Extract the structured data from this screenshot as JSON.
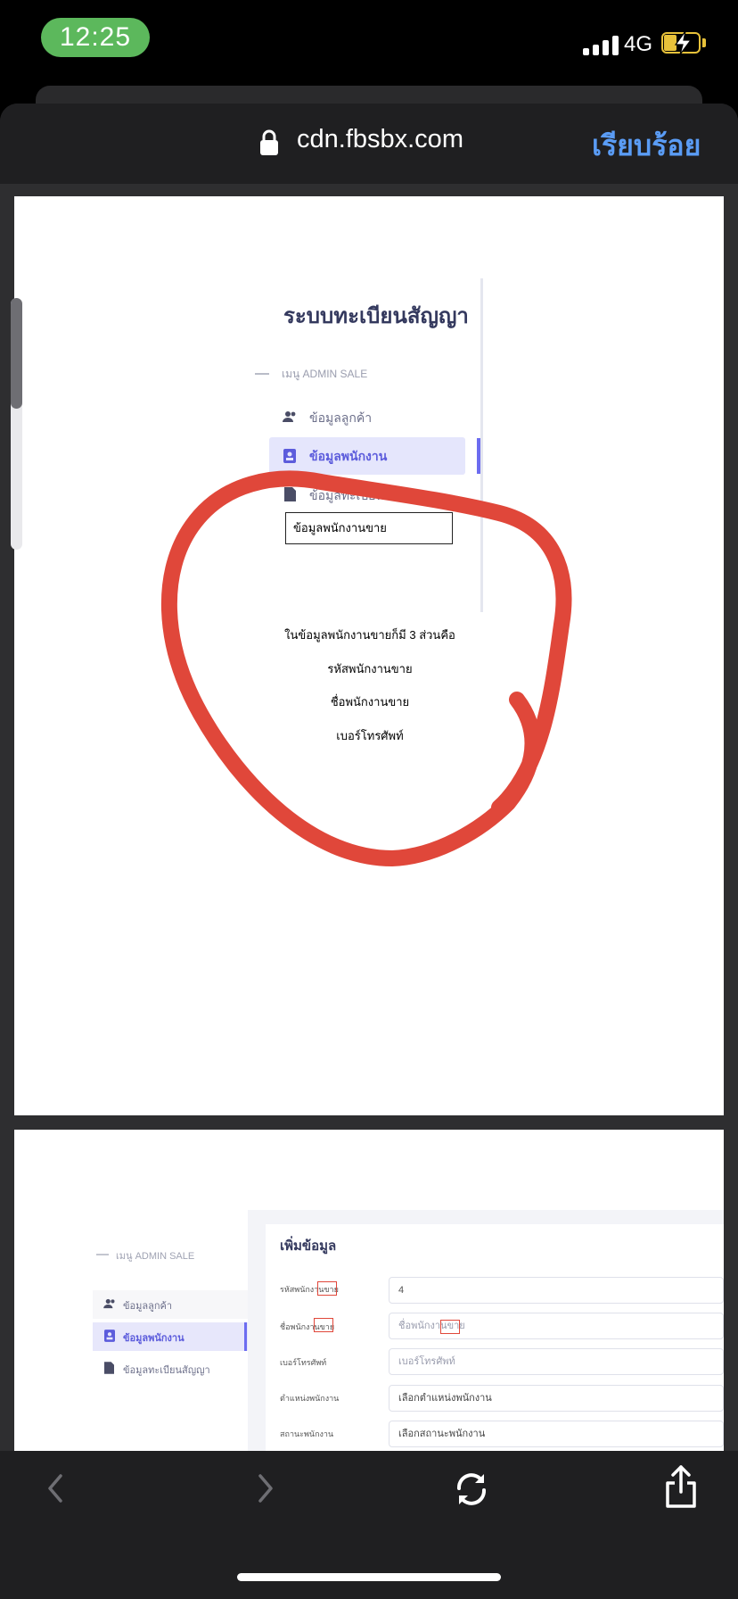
{
  "status_bar": {
    "time": "12:25",
    "network": "4G"
  },
  "browser": {
    "url": "cdn.fbsbx.com",
    "done_label": "เรียบร้อย"
  },
  "page1": {
    "title": "ระบบทะเบียนสัญญา",
    "menu_header": "เมนู ADMIN SALE",
    "menu_items": [
      {
        "label": "ข้อมูลลูกค้า",
        "icon": "users-icon"
      },
      {
        "label": "ข้อมูลพนักงาน",
        "icon": "id-card-icon"
      },
      {
        "label": "ข้อมูลทะเบียน",
        "icon": "document-icon"
      }
    ],
    "callout": "ข้อมูลพนักงานขาย",
    "notes": [
      "ในข้อมูลพนักงานขายก็มี 3 ส่วนคือ",
      "รหัสพนักงานขาย",
      "ชื่อพนักงานขาย",
      "เบอร์โทรศัพท์"
    ]
  },
  "page2": {
    "menu_header": "เมนู ADMIN SALE",
    "menu_items": [
      {
        "label": "ข้อมูลลูกค้า",
        "icon": "users-icon"
      },
      {
        "label": "ข้อมูลพนักงาน",
        "icon": "id-card-icon"
      },
      {
        "label": "ข้อมูลทะเบียนสัญญา",
        "icon": "document-icon"
      }
    ],
    "card_title": "เพิ่มข้อมูล",
    "form": [
      {
        "label": "รหัสพนักงานขาย",
        "value": "4",
        "placeholder": ""
      },
      {
        "label": "ชื่อพนักงานขาย",
        "value": "",
        "placeholder": "ชื่อพนักงานขาย"
      },
      {
        "label": "เบอร์โทรศัพท์",
        "value": "",
        "placeholder": "เบอร์โทรศัพท์"
      },
      {
        "label": "ตำแหน่งพนักงาน",
        "value": "เลือกตำแหน่งพนักงาน",
        "placeholder": ""
      },
      {
        "label": "สถานะพนักงาน",
        "value": "เลือกสถานะพนักงาน",
        "placeholder": ""
      }
    ]
  },
  "colors": {
    "accent": "#5a9cf5",
    "annotation": "#e0473a",
    "active_menu": "#5c5cdc"
  }
}
